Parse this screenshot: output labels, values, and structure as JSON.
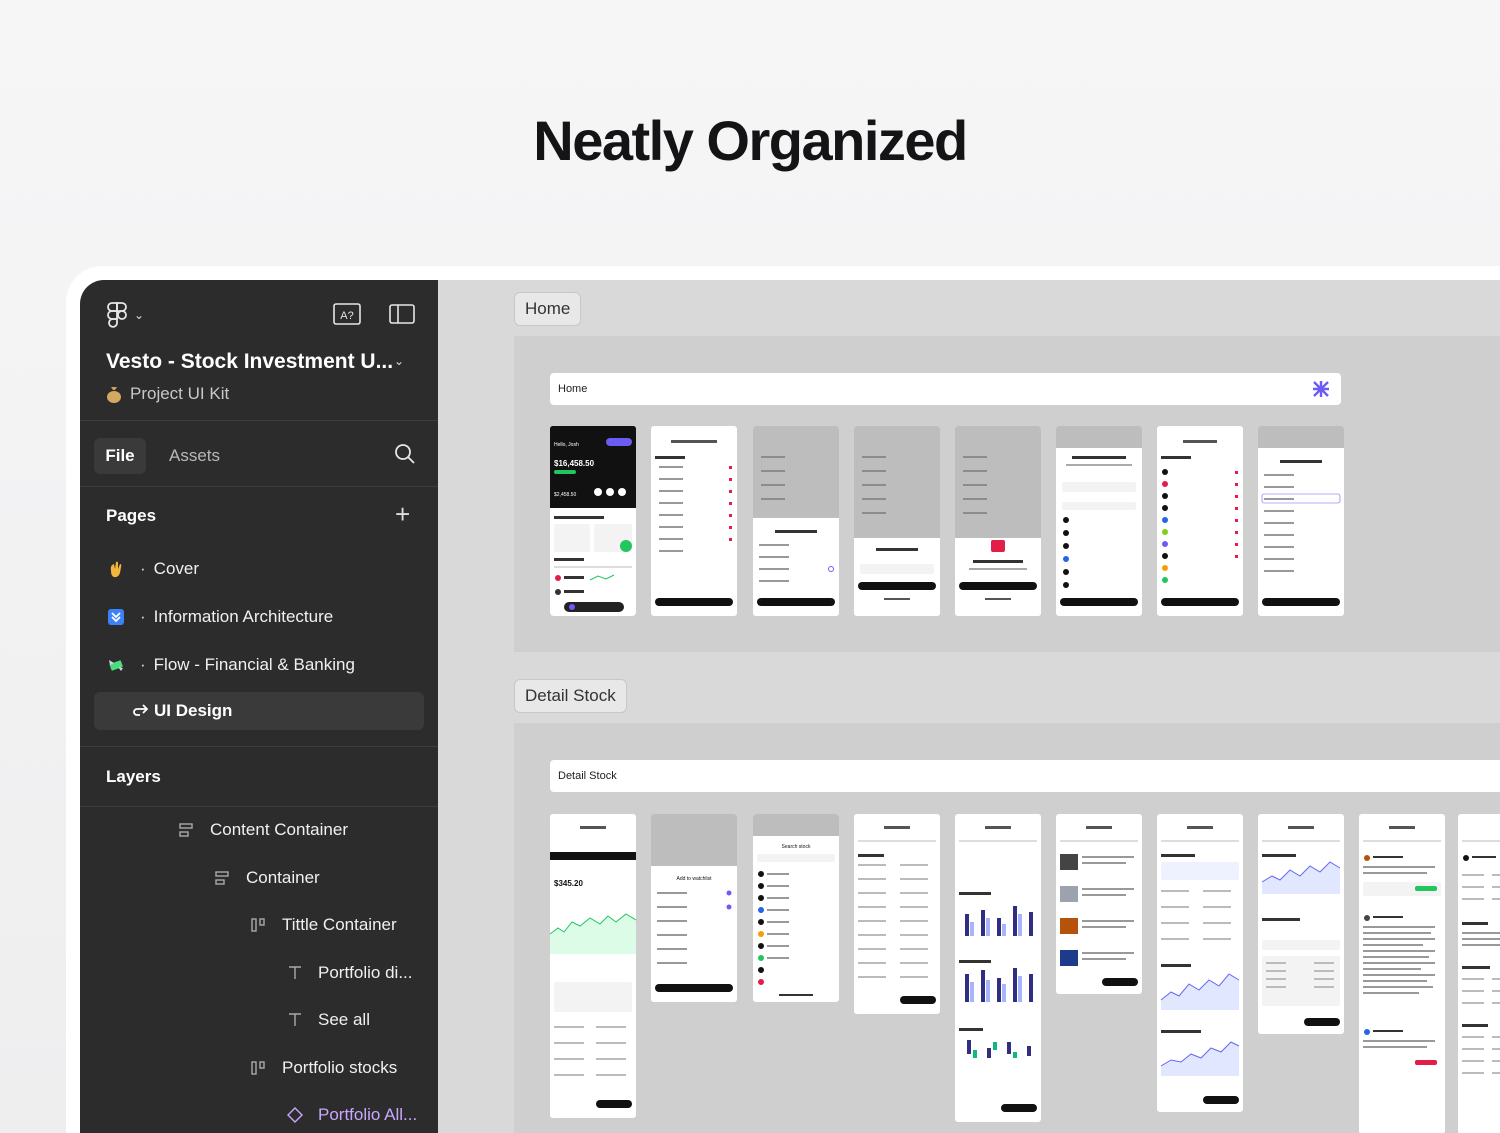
{
  "headline": "Neatly Organized",
  "sidebar": {
    "project_title": "Vesto - Stock Investment U...",
    "project_subtitle": "Project UI Kit",
    "tabs": {
      "file": "File",
      "assets": "Assets"
    },
    "pages_label": "Pages",
    "pages": [
      {
        "label": "Cover"
      },
      {
        "label": "Information Architecture"
      },
      {
        "label": "Flow - Financial & Banking"
      }
    ],
    "active_page": "UI Design",
    "layers_label": "Layers",
    "layers": [
      {
        "label": "Content Container"
      },
      {
        "label": "Container"
      },
      {
        "label": "Tittle Container"
      },
      {
        "label": "Portfolio di..."
      },
      {
        "label": "See all"
      },
      {
        "label": "Portfolio stocks"
      },
      {
        "label": "Portfolio All..."
      }
    ]
  },
  "canvas": {
    "sections": [
      {
        "tag": "Home",
        "header": "Home"
      },
      {
        "tag": "Detail Stock",
        "header": "Detail Stock"
      }
    ],
    "home_phone_sample": {
      "greeting": "Hello, Josh",
      "balance": "$16,458.50",
      "sub_balance": "$2,458.50"
    },
    "detail_phone_sample": {
      "price": "$345.20",
      "add_to_watchlist": "Add to watchlist",
      "search_stock": "Search stock"
    }
  },
  "colors": {
    "sidebar_bg": "#2c2c2c",
    "canvas_bg": "#d9d9d9",
    "accent_purple": "#6b5cf6",
    "positive_green": "#22c55e"
  }
}
